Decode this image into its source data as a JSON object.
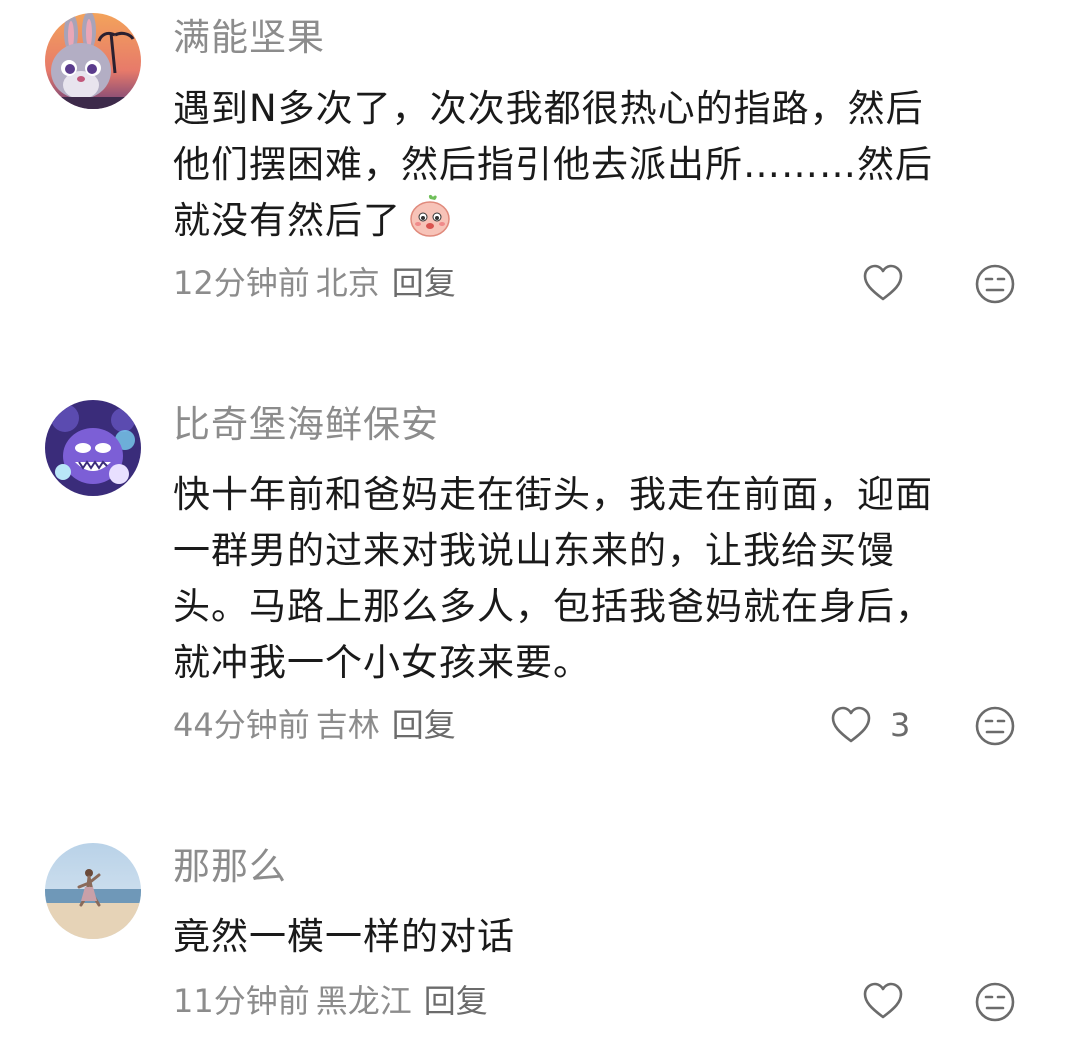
{
  "comments": [
    {
      "username": "满能坚果",
      "lines": [
        "遇到N多次了，次次我都很热心的指路，然后",
        "他们摆困难，然后指引他去派出所………然后",
        "就没有然后了"
      ],
      "time": "12分钟前",
      "location": "北京",
      "reply_label": "回复",
      "like_count": "",
      "avatar_icon": "rabbit-avatar",
      "inline_emoji": "shy-peach-emoji"
    },
    {
      "username": "比奇堡海鲜保安",
      "lines": [
        "快十年前和爸妈走在街头，我走在前面，迎面",
        "一群男的过来对我说山东来的，让我给买馒",
        "头。马路上那么多人，包括我爸妈就在身后，",
        "就冲我一个小女孩来要。"
      ],
      "time": "44分钟前",
      "location": "吉林",
      "reply_label": "回复",
      "like_count": "3",
      "avatar_icon": "purple-monster-avatar"
    },
    {
      "username": "那那么",
      "lines": [
        "竟然一模一样的对话"
      ],
      "time": "11分钟前",
      "location": "黑龙江",
      "reply_label": "回复",
      "like_count": "",
      "avatar_icon": "beach-photo-avatar"
    }
  ],
  "colors": {
    "username": "#8c8c8c",
    "content": "#1a1a1a",
    "meta": "#8c8c8c",
    "icon": "#6b6b6b"
  }
}
